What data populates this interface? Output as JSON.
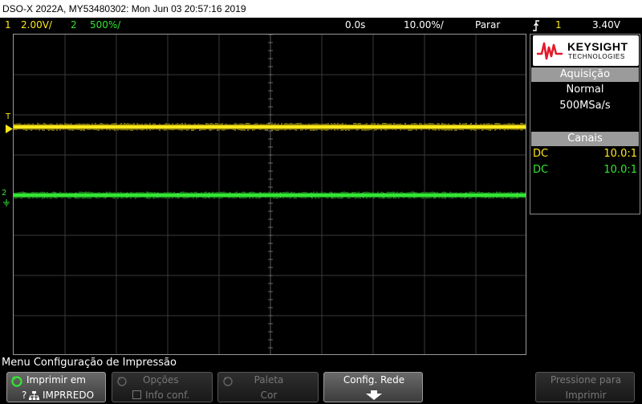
{
  "title": "DSO-X 2022A, MY53480302: Mon Jun 03 20:57:16 2019",
  "status": {
    "ch1_num": "1",
    "ch1_scale": "2.00V/",
    "ch2_num": "2",
    "ch2_scale": "500%/",
    "time_offset": "0.0s",
    "time_scale": "10.00%/",
    "run_state": "Parar",
    "trigger_source": "1",
    "trigger_level": "3.40V"
  },
  "logo": {
    "name": "KEYSIGHT",
    "sub": "TECHNOLOGIES"
  },
  "acquisition": {
    "header": "Aquisição",
    "mode": "Normal",
    "rate": "500MSa/s"
  },
  "channels": {
    "header": "Canais",
    "rows": [
      {
        "coupling": "DC",
        "probe": "10.0:1",
        "color": "#ffe81a"
      },
      {
        "coupling": "DC",
        "probe": "10.0:1",
        "color": "#33e633"
      }
    ]
  },
  "markers": {
    "trigger_marker": "T",
    "ch1_marker": "1",
    "ch2_marker": "2"
  },
  "menu_title": "Menu Configuração de Impressão",
  "softkeys": [
    {
      "line1": "Imprimir em",
      "line2": "IMPRREDO"
    },
    {
      "line1": "Opções",
      "line2": "Info conf."
    },
    {
      "line1": "Paleta",
      "line2": "Cor"
    },
    {
      "line1": "Config. Rede",
      "line2": ""
    },
    {
      "line1": "Pressione para",
      "line2": "Imprimir"
    }
  ],
  "colors": {
    "ch1": "#ffe81a",
    "ch2": "#33e633",
    "trigger_marker": "#ff8c00"
  }
}
